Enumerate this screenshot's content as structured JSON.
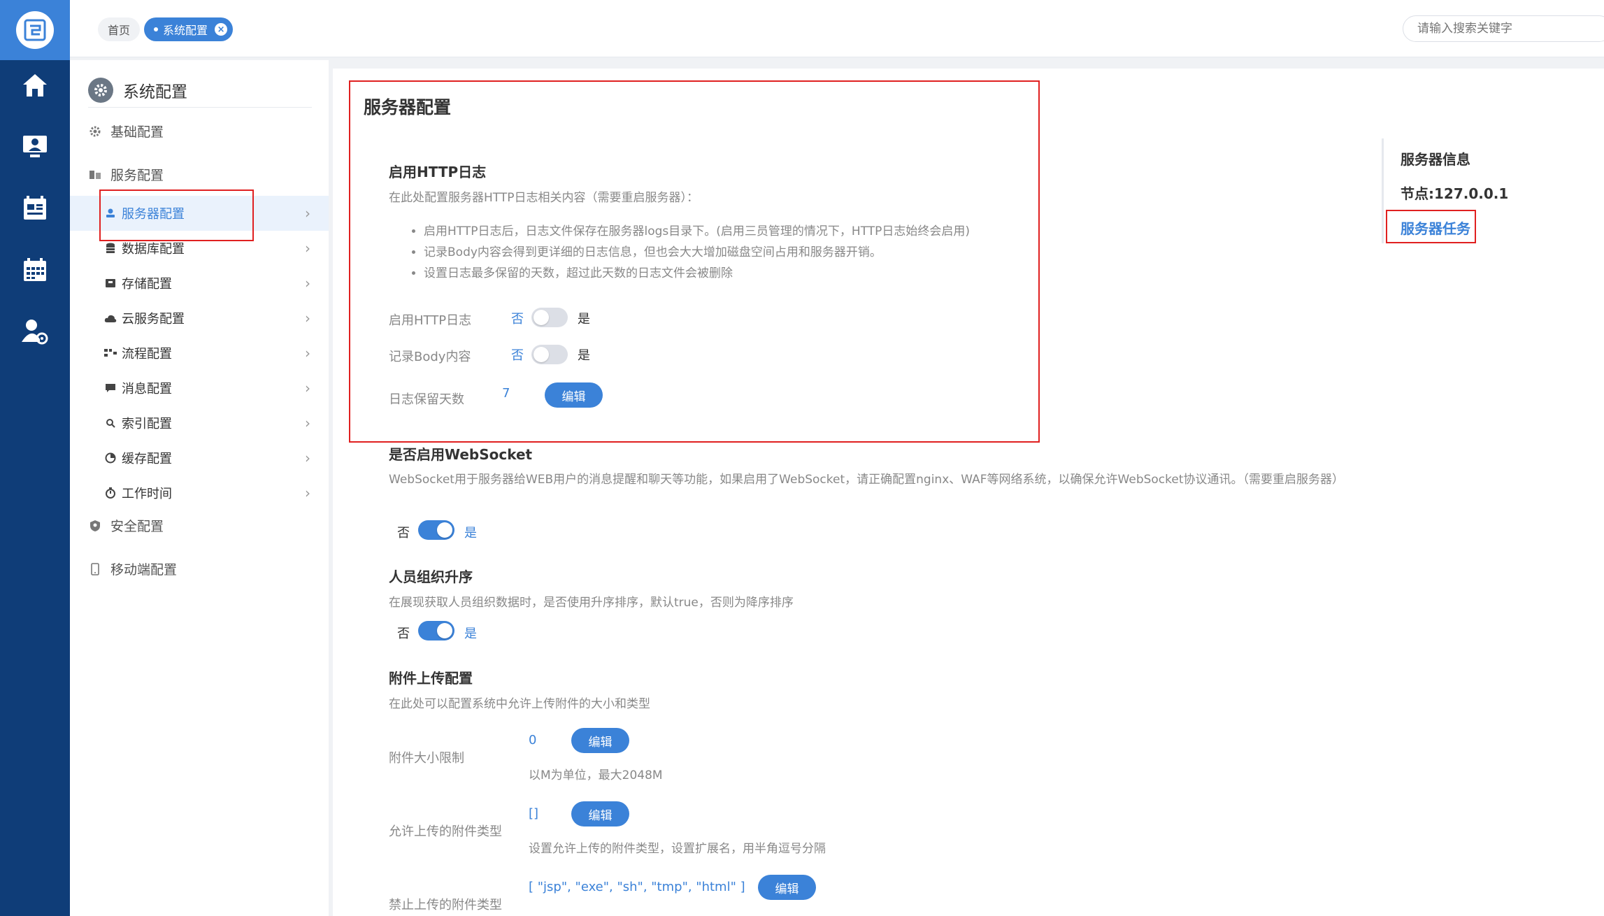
{
  "topbar": {
    "crumb_home": "首页",
    "crumb_active": "系统配置",
    "search_placeholder": "请输入搜索关键字"
  },
  "sidebar": {
    "title": "系统配置",
    "groups": [
      {
        "label": "基础配置"
      },
      {
        "label": "服务配置"
      },
      {
        "label": "安全配置"
      },
      {
        "label": "移动端配置"
      }
    ],
    "items": [
      {
        "label": "服务器配置"
      },
      {
        "label": "数据库配置"
      },
      {
        "label": "存储配置"
      },
      {
        "label": "云服务配置"
      },
      {
        "label": "流程配置"
      },
      {
        "label": "消息配置"
      },
      {
        "label": "索引配置"
      },
      {
        "label": "缓存配置"
      },
      {
        "label": "工作时间"
      }
    ]
  },
  "main": {
    "title": "服务器配置",
    "http_log": {
      "heading": "启用HTTP日志",
      "desc": "在此处配置服务器HTTP日志相关内容（需要重启服务器）：",
      "bullets": [
        "启用HTTP日志后，日志文件保存在服务器logs目录下。(启用三员管理的情况下，HTTP日志始终会启用)",
        "记录Body内容会得到更详细的日志信息，但也会大大增加磁盘空间占用和服务器开销。",
        "设置日志最多保留的天数，超过此天数的日志文件会被删除"
      ],
      "row1_label": "启用HTTP日志",
      "row2_label": "记录Body内容",
      "row3_label": "日志保留天数",
      "row3_value": "7",
      "no": "否",
      "yes": "是",
      "edit": "编辑"
    },
    "websocket": {
      "heading": "是否启用WebSocket",
      "desc": "WebSocket用于服务器给WEB用户的消息提醒和聊天等功能，如果启用了WebSocket，请正确配置nginx、WAF等网络系统，以确保允许WebSocket协议通讯。（需要重启服务器）",
      "no": "否",
      "yes": "是"
    },
    "org_sort": {
      "heading": "人员组织升序",
      "desc": "在展现获取人员组织数据时，是否使用升序排序，默认true，否则为降序排序",
      "no": "否",
      "yes": "是"
    },
    "attachment": {
      "heading": "附件上传配置",
      "desc": "在此处可以配置系统中允许上传附件的大小和类型",
      "size_label": "附件大小限制",
      "size_value": "0",
      "size_hint": "以M为单位，最大2048M",
      "allow_label": "允许上传的附件类型",
      "allow_value": "[]",
      "allow_hint": "设置允许上传的附件类型，设置扩展名，用半角逗号分隔",
      "deny_label": "禁止上传的附件类型",
      "deny_value": "[ \"jsp\", \"exe\", \"sh\", \"tmp\", \"html\" ]",
      "edit": "编辑"
    }
  },
  "anchor_nav": {
    "items": [
      "服务器信息",
      "节点:127.0.0.1",
      "服务器任务"
    ]
  },
  "colors": {
    "accent": "#3b82d8",
    "rail": "#0f3d78",
    "highlight_box": "#e02020"
  }
}
